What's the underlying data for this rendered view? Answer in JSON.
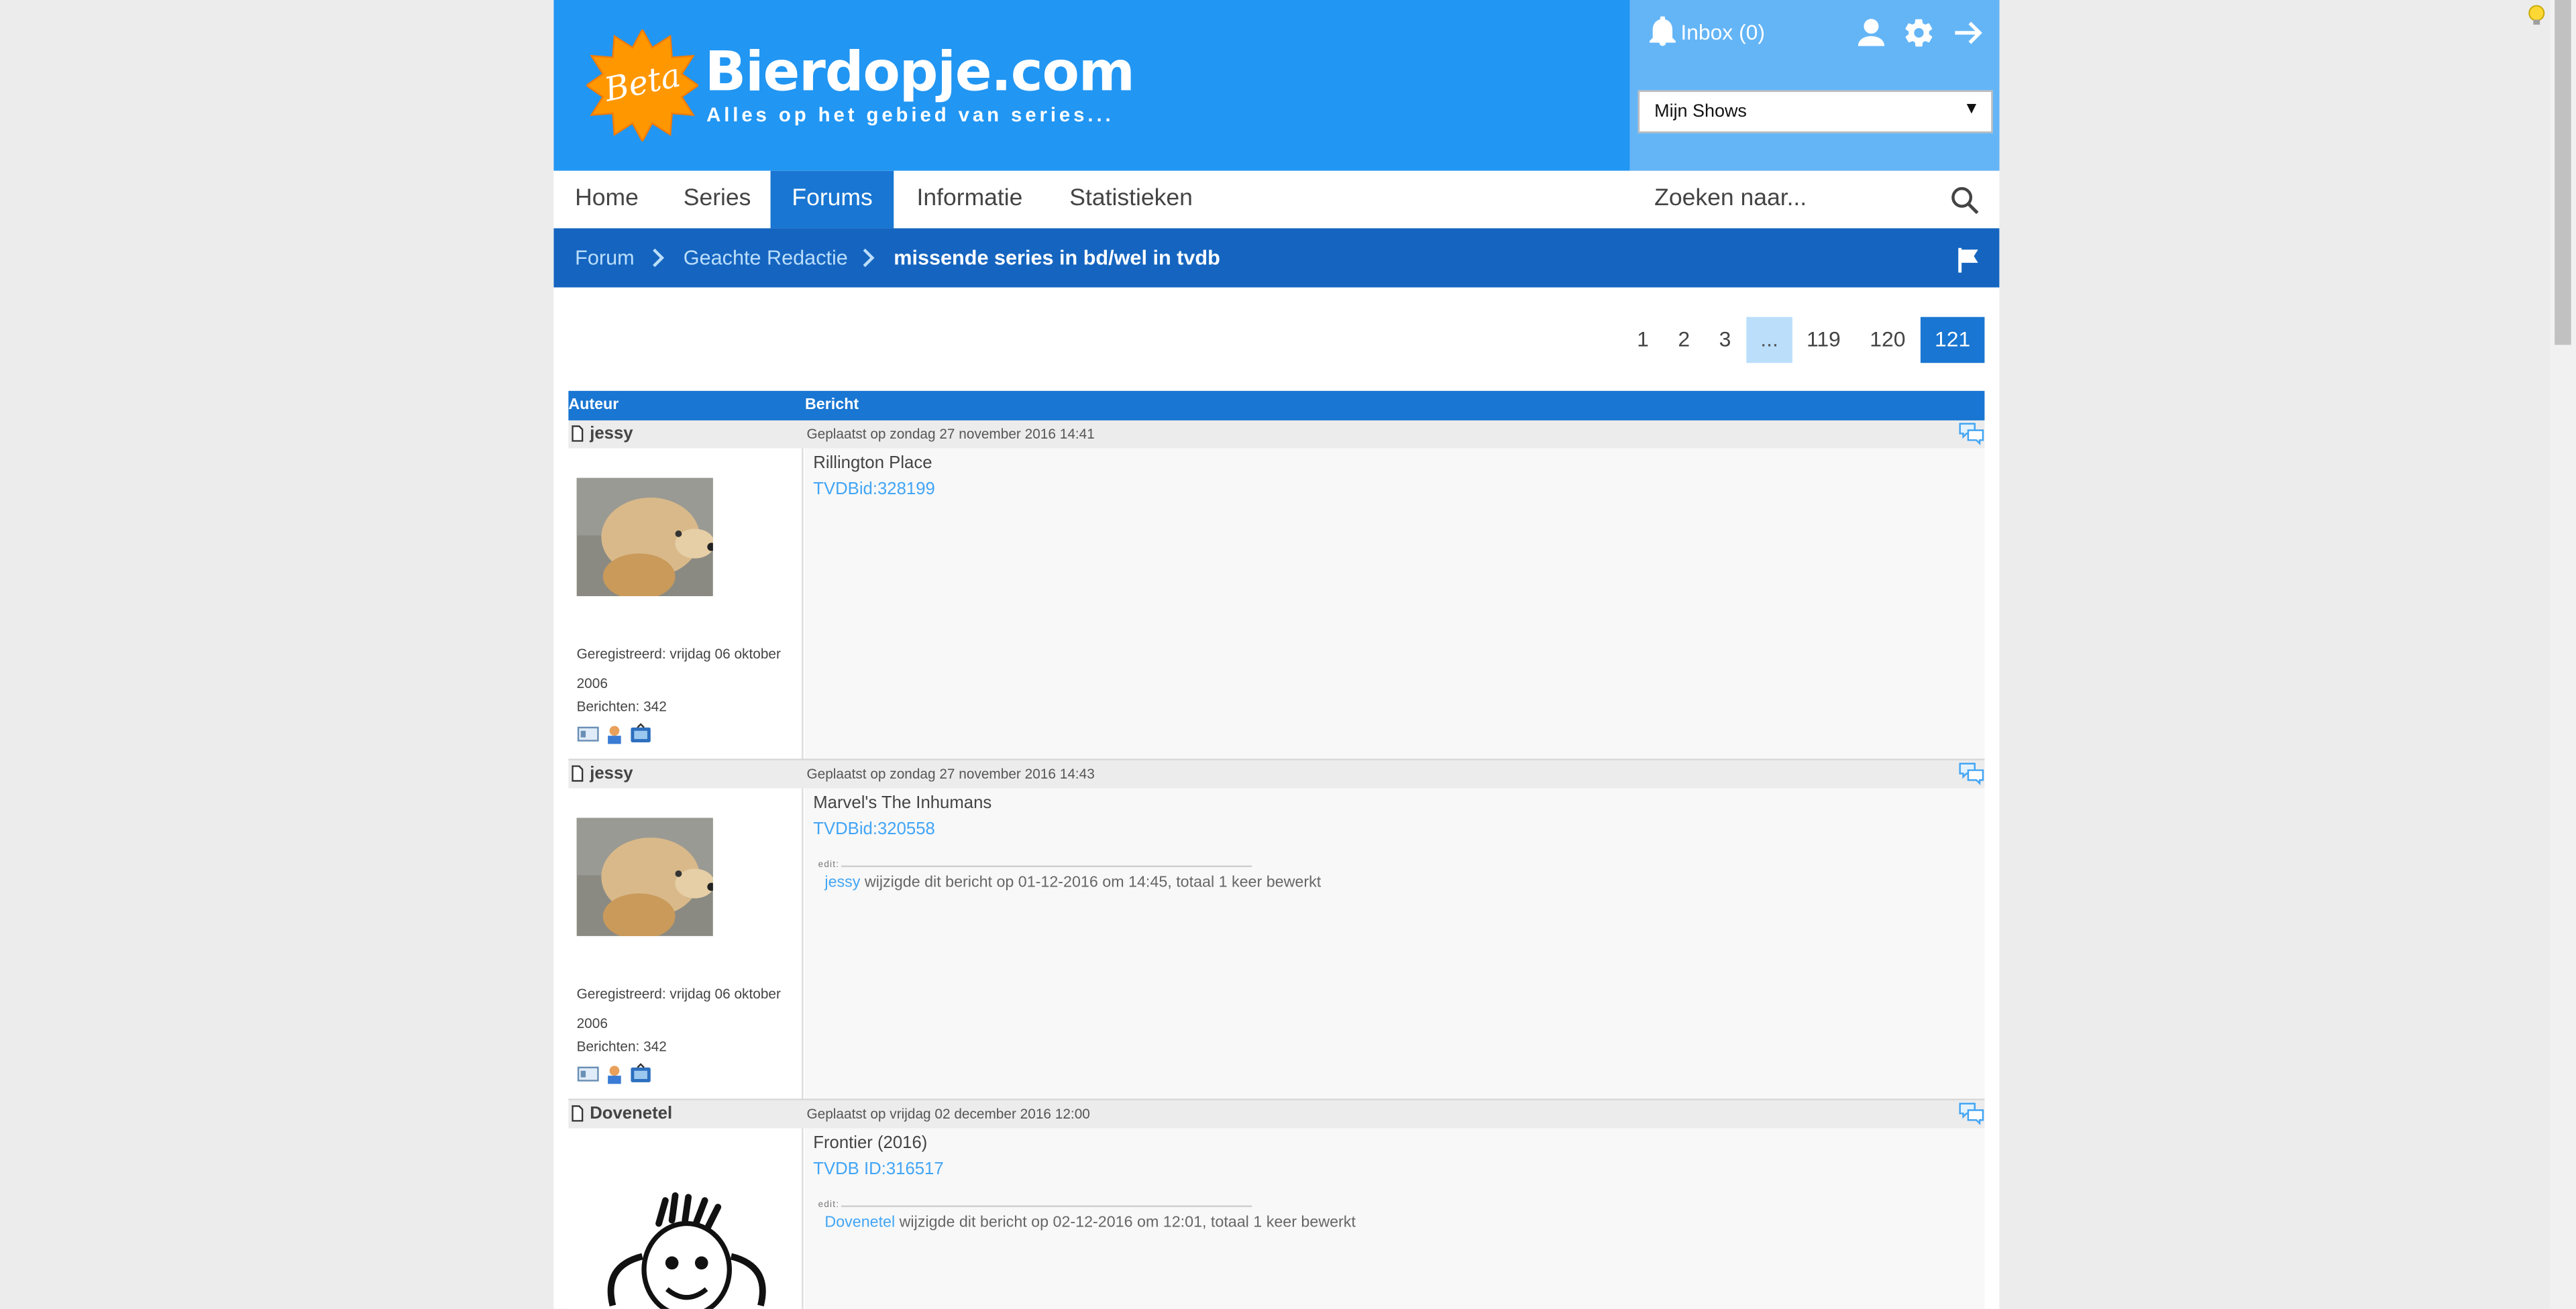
{
  "brand": {
    "badge": "Beta",
    "title": "Bierdopje.com",
    "subtitle": "Alles op het gebied van series..."
  },
  "header": {
    "inbox_label": "Inbox (0)",
    "shows_select": "Mijn Shows"
  },
  "nav": {
    "items": [
      "Home",
      "Series",
      "Forums",
      "Informatie",
      "Statistieken"
    ],
    "active": "Forums",
    "search_placeholder": "Zoeken naar..."
  },
  "breadcrumb": {
    "items": [
      "Forum",
      "Geachte Redactie"
    ],
    "current": "missende series in bd/wel in tvdb"
  },
  "pager": {
    "pages": [
      "1",
      "2",
      "3",
      "...",
      "119",
      "120",
      "121"
    ],
    "current": "121"
  },
  "table": {
    "col_author": "Auteur",
    "col_message": "Bericht"
  },
  "posts": [
    {
      "author": "jessy",
      "date": "Geplaatst op zondag 27 november 2016 14:41",
      "registered": "Geregistreerd: vrijdag 06 oktober 2006",
      "messages": "Berichten: 342",
      "title": "Rillington Place",
      "tvdb": "TVDBid:328199"
    },
    {
      "author": "jessy",
      "date": "Geplaatst op zondag 27 november 2016 14:43",
      "registered": "Geregistreerd: vrijdag 06 oktober 2006",
      "messages": "Berichten: 342",
      "title": "Marvel's The Inhumans",
      "tvdb": "TVDBid:320558",
      "edit_label": "edit:",
      "edit_user": "jessy",
      "edit_text": " wijzigde dit bericht op 01-12-2016 om 14:45, totaal 1 keer bewerkt"
    },
    {
      "author": "Dovenetel",
      "date": "Geplaatst op vrijdag 02 december 2016 12:00",
      "title": "Frontier (2016)",
      "tvdb": "TVDB ID:316517",
      "edit_label": "edit:",
      "edit_user": "Dovenetel",
      "edit_text": " wijzigde dit bericht op 02-12-2016 om 12:01, totaal 1 keer bewerkt"
    }
  ],
  "colors": {
    "header_blue": "#2196f3",
    "nav_active": "#1976d2",
    "breadcrumb_bar": "#1565c0",
    "link": "#42a5f5"
  }
}
